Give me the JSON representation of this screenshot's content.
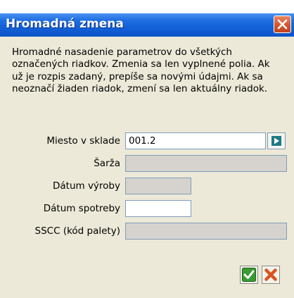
{
  "window": {
    "title": "Hromadná zmena",
    "close_icon": "close-icon"
  },
  "description": "Hromadné nasadenie parametrov do všetkých označených riadkov. Zmenia sa len vyplnené polia. Ak už je rozpis zadaný, prepíše sa novými údajmi. Ak sa neoznačí žiaden riadok, zmení sa len aktuálny riadok.",
  "fields": {
    "location": {
      "label": "Miesto v sklade",
      "value": "001.2"
    },
    "batch": {
      "label": "Šarža",
      "value": ""
    },
    "production_date": {
      "label": "Dátum výroby",
      "value": ""
    },
    "expiry_date": {
      "label": "Dátum spotreby",
      "value": ""
    },
    "sscc": {
      "label": "SSCC (kód palety)",
      "value": ""
    }
  },
  "buttons": {
    "confirm_icon": "check-icon",
    "cancel_icon": "cross-icon"
  },
  "colors": {
    "titlebar": "#1361d8",
    "panel": "#ece9d8",
    "close": "#d2552e"
  }
}
